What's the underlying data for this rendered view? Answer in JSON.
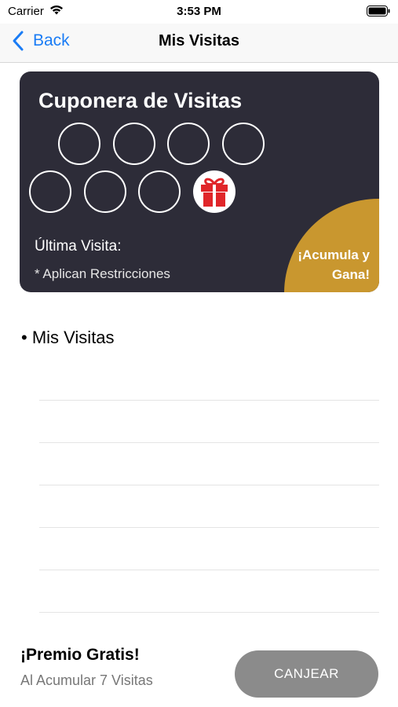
{
  "status_bar": {
    "carrier": "Carrier",
    "time": "3:53 PM"
  },
  "nav": {
    "back_label": "Back",
    "title": "Mis Visitas"
  },
  "card": {
    "title": "Cuponera de Visitas",
    "stamps_total": 7,
    "stamps_filled": 0,
    "last_visit_label": "Última Visita:",
    "restrictions": "* Aplican Restricciones",
    "promo": "¡Acumula y Gana!",
    "background_color": "#2d2c38",
    "promo_color": "#c9972f",
    "gift_color": "#e0262a"
  },
  "visits": {
    "heading": "• Mis Visitas"
  },
  "footer": {
    "premio_title": "¡Premio Gratis!",
    "premio_subtitle": "Al Acumular 7 Visitas",
    "canjear_label": "CANJEAR"
  },
  "colors": {
    "accent": "#1a7cf5",
    "button_disabled": "#8b8b8b"
  }
}
